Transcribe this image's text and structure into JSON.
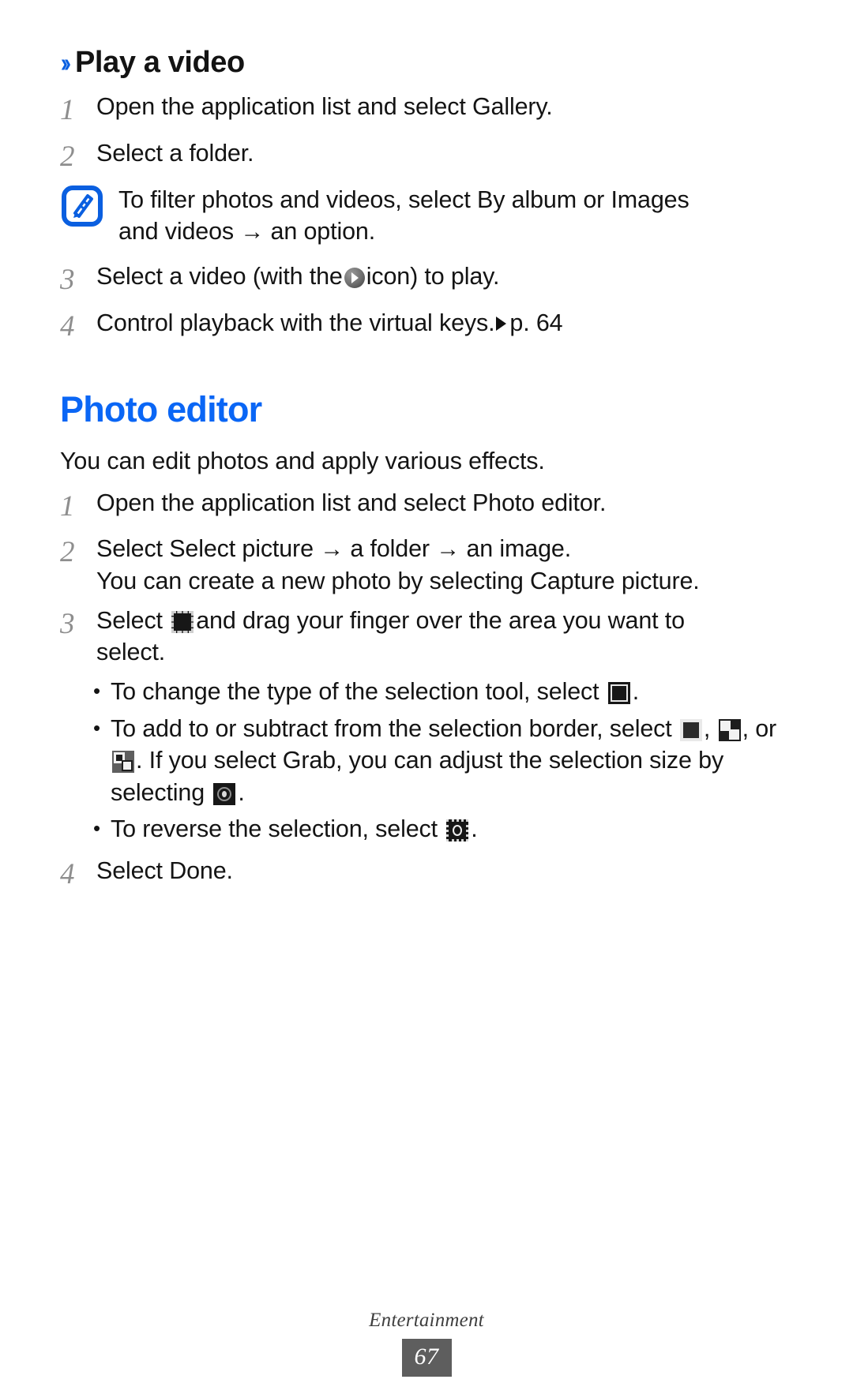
{
  "document": {
    "section_heading": "Play a video",
    "chevron": "››",
    "main_heading": "Photo editor",
    "accent_color": "#0a66f5",
    "note_icon_color": "#0a5fe0"
  },
  "play_video": {
    "steps": [
      {
        "num": "1",
        "text": "Open the application list and select Gallery."
      },
      {
        "num": "2",
        "text": "Select a folder."
      }
    ],
    "note": {
      "icon": "note-pencil-icon",
      "line1": "To filter photos and videos, select By album or Images",
      "line2_pre": "and videos",
      "line2_arrow": "→",
      "line2_post": "an option."
    },
    "step3": {
      "num": "3",
      "pre": "Select a video (with the",
      "icon": "play-circle-icon",
      "post": "icon) to play."
    },
    "step4": {
      "num": "4",
      "pre": "Control playback with the virtual keys.",
      "icon": "play-triangle-icon",
      "page_ref": "p. 64"
    }
  },
  "photo_editor": {
    "intro": "You can edit photos and apply various effects.",
    "step1": {
      "num": "1",
      "text": "Open the application list and select Photo editor."
    },
    "step2": {
      "num": "2",
      "line1_pre": "Select Select picture",
      "line1_arrow1": "→",
      "line1_mid": "a folder",
      "line1_arrow2": "→",
      "line1_post": "an image.",
      "line2": "You can create a new photo by selecting Capture picture."
    },
    "step3": {
      "num": "3",
      "pre": "Select",
      "icon": "marquee-select-icon",
      "post": "and drag your finger over the area you want to",
      "line2": "select.",
      "bullets": [
        {
          "dot": "•",
          "pre": "To change the type of the selection tool, select",
          "icons": [
            "selection-tool-icon"
          ],
          "post": "."
        },
        {
          "dot": "•",
          "pre": "To add to or subtract from the selection border, select",
          "icons": [
            "new-selection-icon",
            "add-selection-icon",
            "subtract-selection-icon"
          ],
          "sep1": ",",
          "sep2": ", or",
          "mid": ". If you select Grab, you can adjust the",
          "line2_pre": "selection size by selecting",
          "grab_icon": "grab-resize-icon",
          "line2_post": "."
        },
        {
          "dot": "•",
          "pre": "To reverse the selection, select",
          "icons": [
            "invert-selection-icon"
          ],
          "post": "."
        }
      ]
    },
    "step4": {
      "num": "4",
      "text": "Select Done."
    }
  },
  "footer": {
    "section": "Entertainment",
    "page_number": "67"
  }
}
